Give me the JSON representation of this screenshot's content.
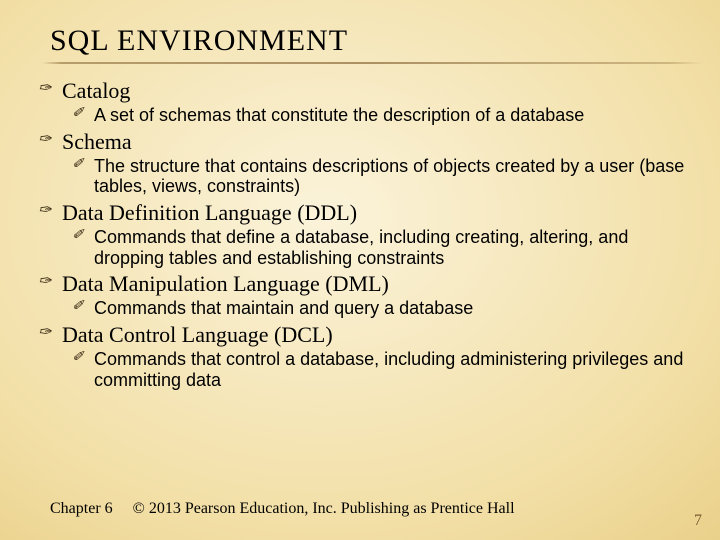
{
  "title": "SQL ENVIRONMENT",
  "items": [
    {
      "term": "Catalog",
      "desc": "A set of schemas that constitute the description of a database"
    },
    {
      "term": "Schema",
      "desc": "The structure that contains descriptions of objects created by a user (base tables, views, constraints)"
    },
    {
      "term": "Data Definition Language (DDL)",
      "desc": "Commands that define a database, including creating, altering, and dropping tables and establishing constraints"
    },
    {
      "term": "Data Manipulation Language (DML)",
      "desc": "Commands that maintain and query a database"
    },
    {
      "term": "Data Control Language (DCL)",
      "desc": "Commands that control a database, including administering privileges and committing data"
    }
  ],
  "footer": {
    "chapter": "Chapter 6",
    "copyright": "© 2013 Pearson Education, Inc.  Publishing as Prentice Hall"
  },
  "page": "7",
  "glyphs": {
    "main": "✑",
    "sub": "✐"
  }
}
